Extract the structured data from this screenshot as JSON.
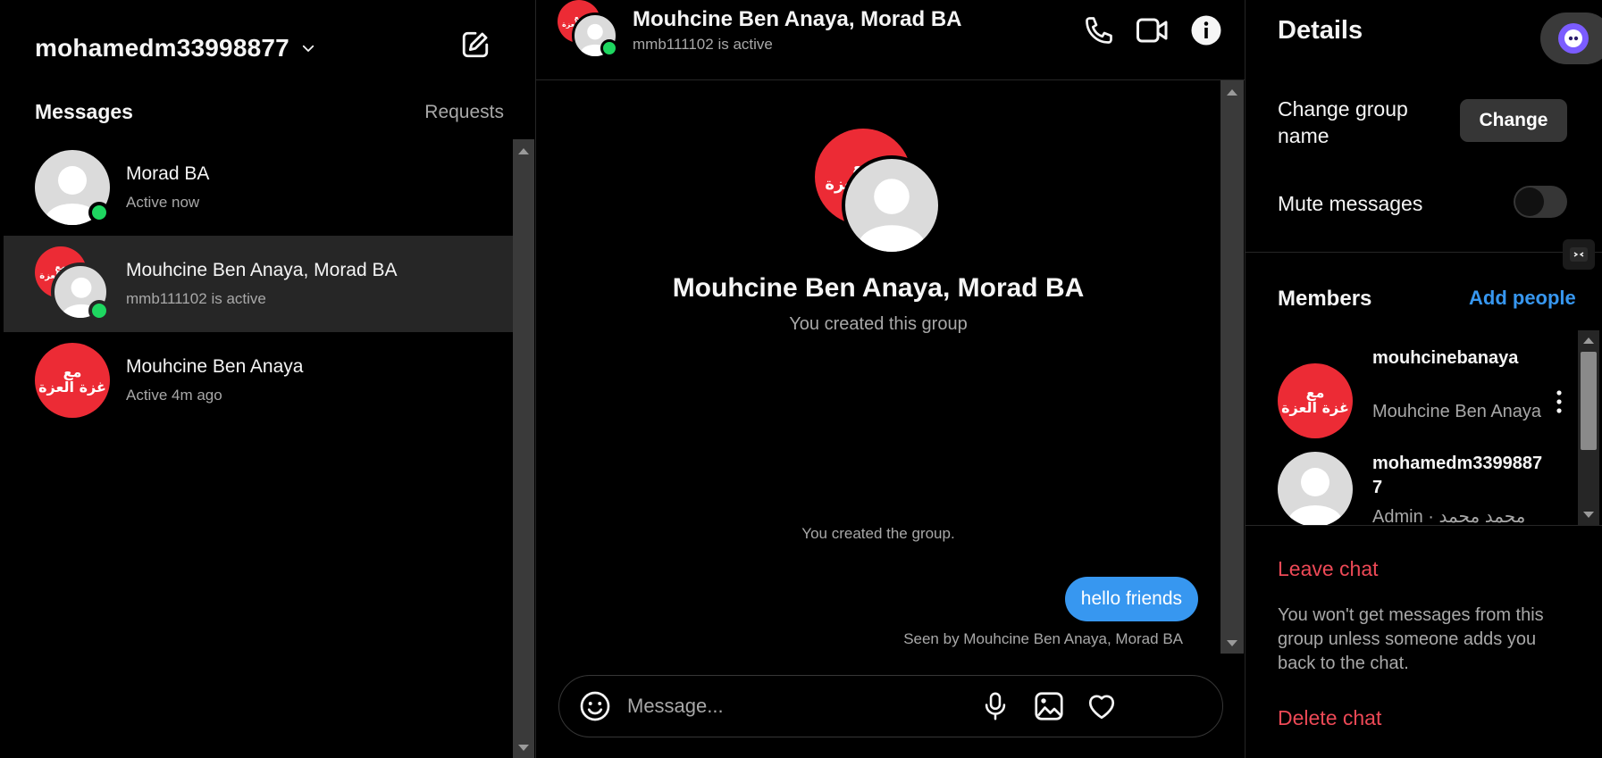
{
  "inbox": {
    "username": "mohamedm33998877",
    "tabs": {
      "messages": "Messages",
      "requests": "Requests"
    },
    "conversations": [
      {
        "name": "Morad BA",
        "status": "Active now",
        "avatar": "default",
        "online": true
      },
      {
        "name": "Mouhcine Ben Anaya, Morad BA",
        "status": "mmb111102 is active",
        "avatar": "group",
        "online": true,
        "active": true
      },
      {
        "name": "Mouhcine Ben Anaya",
        "status": "Active 4m ago",
        "avatar": "red-arabic",
        "online": false
      }
    ]
  },
  "avatar_text": {
    "line1": "مع",
    "line2": "غزة العزة"
  },
  "chat": {
    "title": "Mouhcine Ben Anaya, Morad BA",
    "status": "mmb111102 is active",
    "group_name": "Mouhcine Ben Anaya, Morad BA",
    "group_created": "You created this group",
    "system_message": "You created the group.",
    "messages": [
      {
        "text": "hello friends",
        "from": "me"
      }
    ],
    "seen_by": "Seen by Mouhcine Ben Anaya, Morad BA",
    "composer_placeholder": "Message..."
  },
  "details": {
    "title": "Details",
    "change_group_name_label": "Change group name",
    "change_button": "Change",
    "mute_label": "Mute messages",
    "mute_on": false,
    "members_title": "Members",
    "add_people": "Add people",
    "members": [
      {
        "username": "mouhcinebanaya",
        "subtitle": "Mouhcine Ben Anaya",
        "avatar": "red-arabic"
      },
      {
        "username": "mohamedm33998877",
        "subtitle": "Admin · محمد محمد",
        "avatar": "default"
      }
    ],
    "leave_chat": "Leave chat",
    "leave_note": "You won't get messages from this group unless someone adds you back to the chat.",
    "delete_chat": "Delete chat"
  },
  "colors": {
    "accent": "#3797f0",
    "danger": "#ed4956",
    "online": "#1ed760",
    "avatar_red": "#ec2b35"
  },
  "icons": [
    "chevron-down-icon",
    "compose-icon",
    "phone-icon",
    "video-icon",
    "info-icon",
    "emoji-icon",
    "microphone-icon",
    "image-icon",
    "heart-icon",
    "more-icon"
  ]
}
